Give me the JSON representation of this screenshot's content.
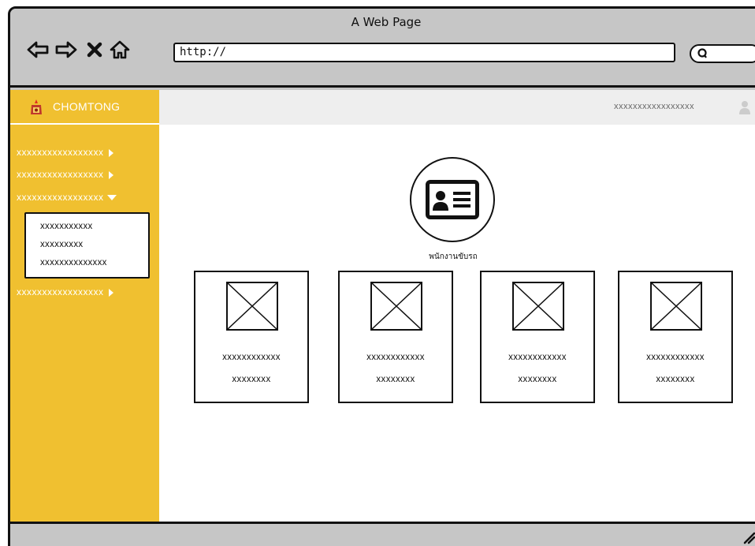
{
  "window": {
    "title": "A Web Page"
  },
  "browser": {
    "url": "http://",
    "nav_icons": [
      "back-arrow-icon",
      "forward-arrow-icon",
      "close-icon",
      "home-icon"
    ],
    "search_icon": "search-icon"
  },
  "sidebar": {
    "brand": "CHOMTONG",
    "items": [
      {
        "label": "xxxxxxxxxxxxxxxxx",
        "caret": "right"
      },
      {
        "label": "xxxxxxxxxxxxxxxxx",
        "caret": "right"
      },
      {
        "label": "xxxxxxxxxxxxxxxxx",
        "caret": "down"
      },
      {
        "label": "xxxxxxxxxxxxxxxxx",
        "caret": "right"
      }
    ],
    "submenu": [
      "xxxxxxxxxxx",
      "xxxxxxxxx",
      "xxxxxxxxxxxxxx"
    ],
    "color": "#f0c030"
  },
  "topbar": {
    "user": "xxxxxxxxxxxxxxxxx"
  },
  "main": {
    "profile_label": "พนักงานขับรถ",
    "cards": [
      {
        "title": "xxxxxxxxxxxx",
        "subtitle": "xxxxxxxx"
      },
      {
        "title": "xxxxxxxxxxxx",
        "subtitle": "xxxxxxxx"
      },
      {
        "title": "xxxxxxxxxxxx",
        "subtitle": "xxxxxxxx"
      },
      {
        "title": "xxxxxxxxxxxx",
        "subtitle": "xxxxxxxx"
      }
    ]
  }
}
